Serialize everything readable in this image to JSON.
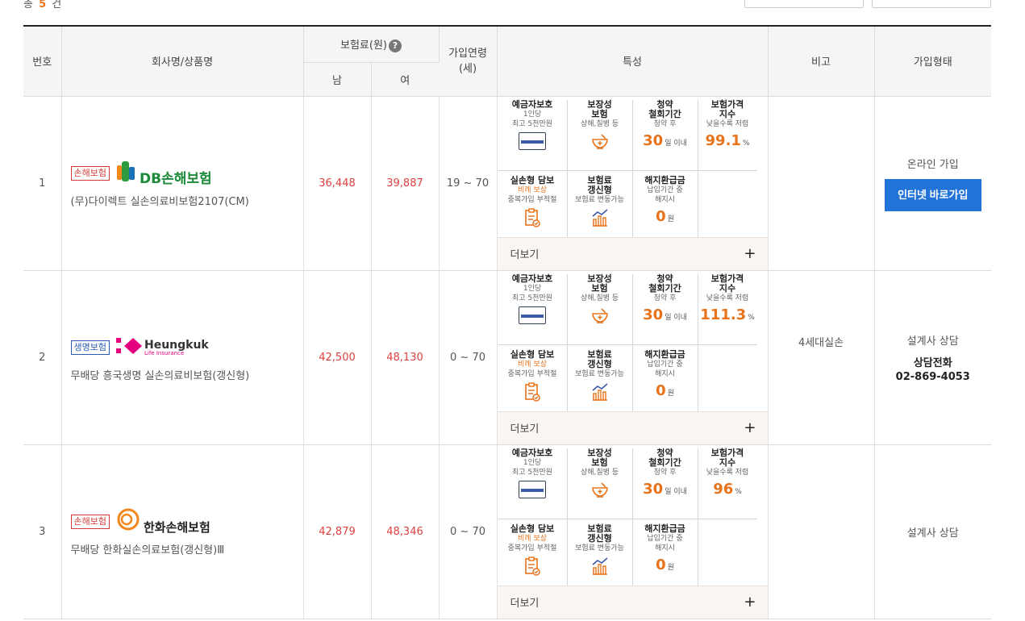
{
  "summary": {
    "prefix": "총",
    "count": "5",
    "suffix": "건"
  },
  "headers": {
    "no": "번호",
    "company": "회사명/상품명",
    "premium": "보험료(원)",
    "male": "남",
    "female": "여",
    "age": "가입연령\n(세)",
    "features": "특성",
    "remark": "비고",
    "join": "가입형태"
  },
  "features_labels": {
    "deposit_t": "예금자보호",
    "deposit_s1": "1인당",
    "deposit_s2": "최고 5천만원",
    "cov_t1": "보장성",
    "cov_t2": "보험",
    "cov_s": "상해,질병 등",
    "withdraw_t1": "청약",
    "withdraw_t2": "철회기간",
    "withdraw_s": "청약 후",
    "withdraw_v": "30",
    "withdraw_u": "일 이내",
    "index_t1": "보험가격",
    "index_t2": "지수",
    "index_s": "낮을수록 저렴",
    "index_u": "%",
    "real_t": "실손형 담보",
    "real_s1": "비례 보상",
    "real_s2": "중복가입 부적절",
    "renew_t1": "보험료",
    "renew_t2": "갱신형",
    "renew_s": "보험료 변동가능",
    "refund_t": "해지환급금",
    "refund_s1": "납입기간 중",
    "refund_s2": "해지시",
    "refund_v": "0",
    "refund_u": "원",
    "more": "더보기"
  },
  "rows": [
    {
      "no": "1",
      "badge": "손해보험",
      "badge_color": "#d23c3c",
      "brand": "DB손해보험",
      "product": "(무)다이렉트 실손의료비보험2107(CM)",
      "male": "36,448",
      "female": "39,887",
      "age": "19 ~ 70",
      "index": "99.1",
      "remark": "",
      "join_label": "온라인 가입",
      "join_button": "인터넷 바로가입"
    },
    {
      "no": "2",
      "badge": "생명보험",
      "badge_color": "#2a5bb5",
      "brand": "Heungkuk",
      "brand_sub": "Life Insurance",
      "product": "무배당 흥국생명 실손의료비보험(갱신형)",
      "male": "42,500",
      "female": "48,130",
      "age": "0 ~ 70",
      "index": "111.3",
      "remark": "4세대실손",
      "join_label": "설계사 상담",
      "phone_title": "상담전화",
      "phone": "02-869-4053"
    },
    {
      "no": "3",
      "badge": "손해보험",
      "badge_color": "#d23c3c",
      "brand": "한화손해보험",
      "product": "무배당 한화실손의료보험(갱신형)Ⅲ",
      "male": "42,879",
      "female": "48,346",
      "age": "0 ~ 70",
      "index": "96",
      "remark": "",
      "join_label": "설계사 상담"
    }
  ]
}
